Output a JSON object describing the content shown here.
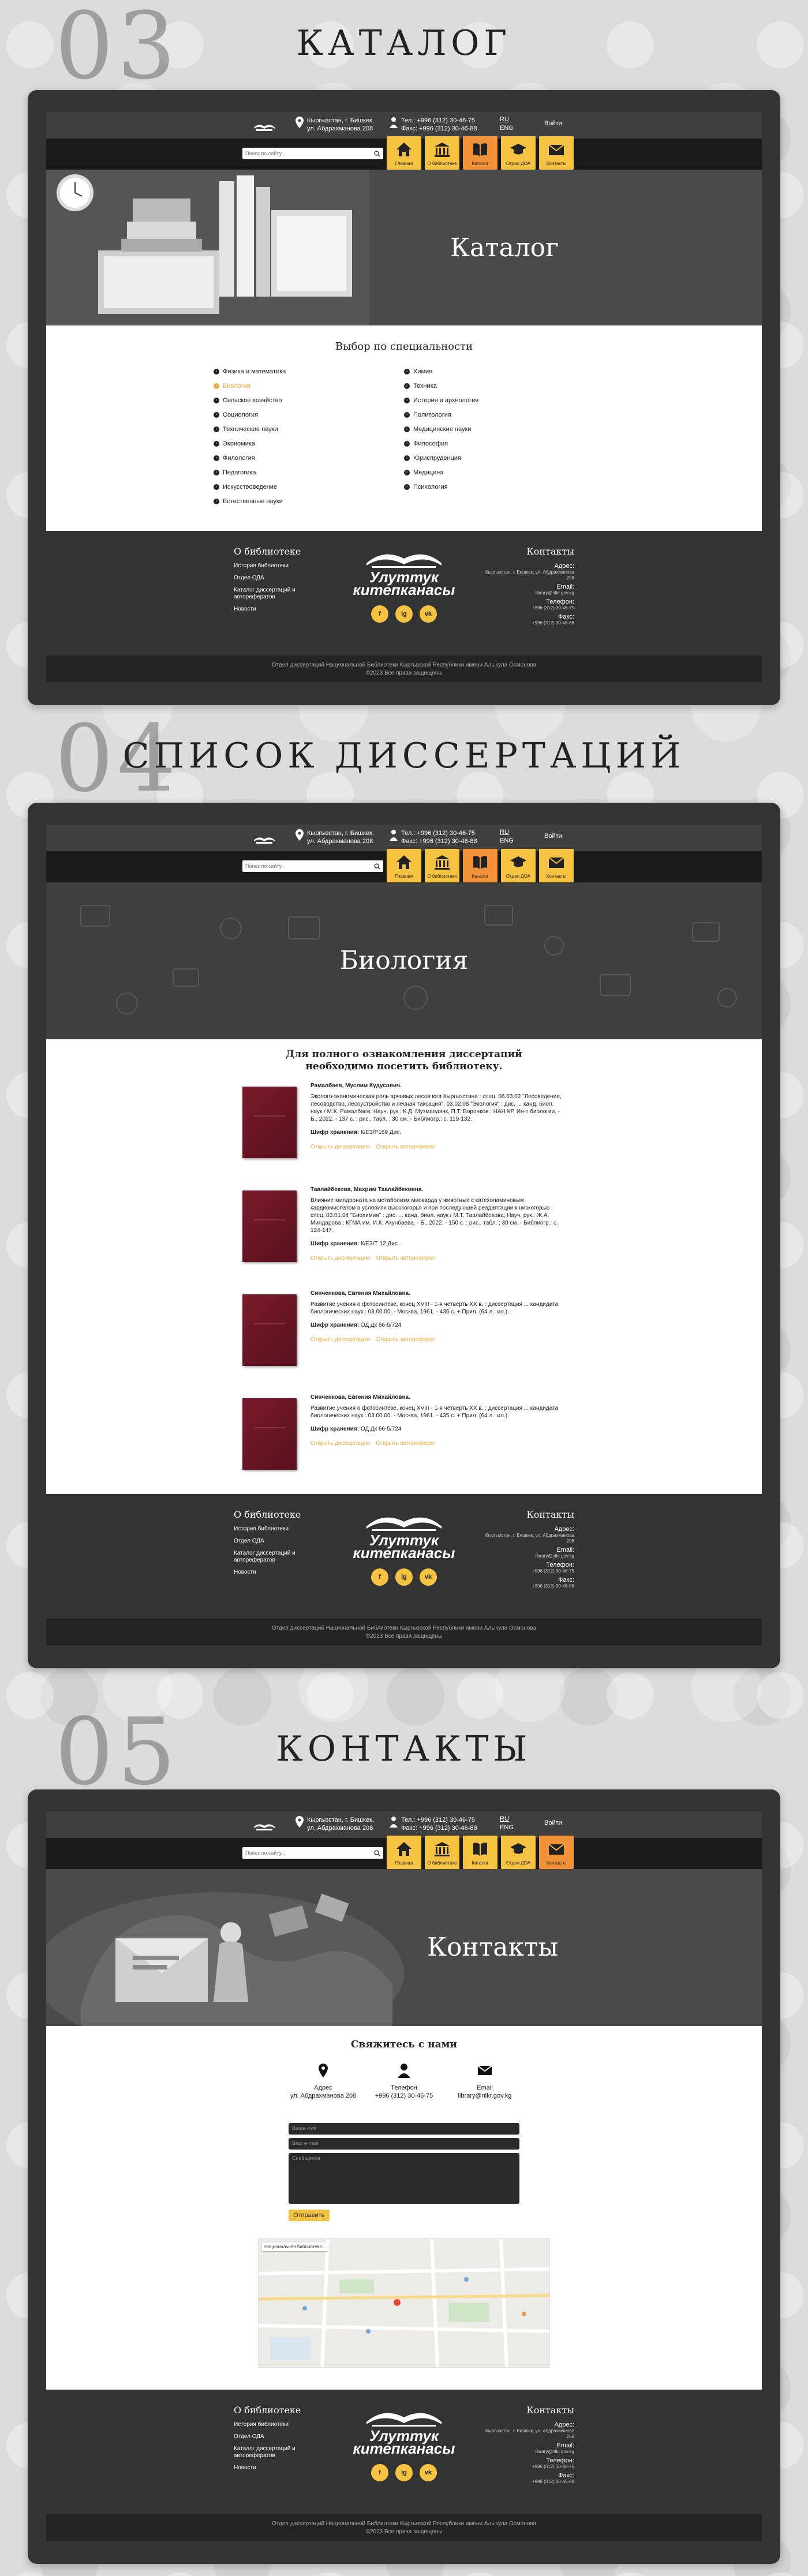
{
  "sections": [
    {
      "num": "03",
      "title": "КАТАЛОГ"
    },
    {
      "num": "04",
      "title": "СПИСОК ДИССЕРТАЦИЙ"
    },
    {
      "num": "05",
      "title": "КОНТАКТЫ"
    }
  ],
  "header": {
    "address": [
      "Кыргызстан, г. Бишкек,",
      "ул. Абдрахманова 208"
    ],
    "phone": "Тел.: +996 (312) 30-46-75",
    "fax": "Факс: +996 (312) 30-46-88",
    "lang_ru": "RU",
    "lang_en": "ENG",
    "login": "Войти",
    "search_placeholder": "Поиск по сайту...",
    "nav": [
      {
        "label": "Главная",
        "icon": "home-icon"
      },
      {
        "label": "О библиотеке",
        "icon": "library-icon"
      },
      {
        "label": "Каталог",
        "icon": "book-icon"
      },
      {
        "label": "Отдел ДОА",
        "icon": "graduation-cap-icon"
      },
      {
        "label": "Контакты",
        "icon": "mail-icon"
      }
    ]
  },
  "catalog": {
    "hero_title": "Каталог",
    "heading": "Выбор по специальности",
    "specialties": [
      {
        "label": "Физика и математика",
        "active": false
      },
      {
        "label": "Биология",
        "active": true
      },
      {
        "label": "Сельское хозяйство",
        "active": false
      },
      {
        "label": "Социология",
        "active": false
      },
      {
        "label": "Технические науки",
        "active": false
      },
      {
        "label": "Экономика",
        "active": false
      },
      {
        "label": "Филология",
        "active": false
      },
      {
        "label": "Педагогика",
        "active": false
      },
      {
        "label": "Искусствоведение",
        "active": false
      },
      {
        "label": "Естественные науки",
        "active": false
      },
      {
        "label": "Химия",
        "active": false
      },
      {
        "label": "Техника",
        "active": false
      },
      {
        "label": "История и археология",
        "active": false
      },
      {
        "label": "Политология",
        "active": false
      },
      {
        "label": "Медицинские науки",
        "active": false
      },
      {
        "label": "Философия",
        "active": false
      },
      {
        "label": "Юриспруденция",
        "active": false
      },
      {
        "label": "Медицина",
        "active": false
      },
      {
        "label": "Психология",
        "active": false
      }
    ]
  },
  "dissertations": {
    "hero_title": "Биология",
    "heading": "Для полного ознакомления диссертаций необходимо посетить библиотеку.",
    "cipher_label": "Шифр хранения:",
    "open_diss": "Открыть диссертацию",
    "open_abstract": "Открыть автореферат",
    "entries": [
      {
        "author": "Рамалбаев, Муслим Кудусович.",
        "desc": "Эколого-экономическая роль арчовых лесов юга Кыргызстана : спец. 06.03.02 \"Лесоведение, лесоводство, лесоустройство и лесная таксация\", 03.02.08 \"Экология\" : дис. ... канд. биол. наук / М.К. Рамалбаев; Науч. рук.: К.Д. Музмаедэнк, П.Т. Воронков ; НАН КР, Ин-т биологии. - Б., 2022. - 137 с. : рис., табл. ; 30 см. - Библиогр.: с. 119-132.",
        "cipher": "К/ЕЗ/Р169 Дис."
      },
      {
        "author": "Таалайбекова, Махрим Таалайбековна.",
        "desc": "Влияние милдроната на метаболизм миокарда у животных с катехоламиновым кардиомиопатом в условиях высокогорья и при последующей реадаптации к низкогорью : спец. 03.01.04 \"Биохимия\" : дис. ... канд. биол. наук / М.Т. Таалайбекова; Науч. рук.: Ж.А. Миндарова ; КГМА им. И.К. Ахунбаева. - Б., 2022. - 150 с. : рис., табл. ; 30 см. - Библиогр.: с. 124-147.",
        "cipher": "К/ЕЗ/Т 12 Дис."
      },
      {
        "author": "Синченкова, Евгения Михайловна.",
        "desc": "Развитие учения о фотосинтезе, конец XVIII - 1-я четверть XX в. : диссертация ... кандидата биологических наук : 03.00.00. - Москва, 1961. - 435 с. + Прил. (64 л.: ил.).",
        "cipher": "ОД Дк 66-5/724"
      },
      {
        "author": "Синченкова, Евгения Михайловна.",
        "desc": "Развитие учения о фотосинтезе, конец XVIII - 1-я четверть XX в. : диссертация ... кандидата биологических наук : 03.00.00. - Москва, 1961. - 435 с. + Прил. (64 л.: ил.).",
        "cipher": "ОД Дк 66-5/724"
      }
    ]
  },
  "contacts": {
    "hero_title": "Контакты",
    "heading": "Свяжитесь с нами",
    "items": [
      {
        "title": "Адрес",
        "value": "ул. Абдрахманова 208",
        "icon": "map-pin-icon"
      },
      {
        "title": "Телефон",
        "value": "+996 (312) 30-46-75",
        "icon": "person-icon"
      },
      {
        "title": "Email",
        "value": "library@nlkr.gov.kg",
        "icon": "envelope-icon"
      }
    ],
    "form": {
      "name_placeholder": "Ваше имя",
      "email_placeholder": "Ваш e-mail",
      "message_placeholder": "Сообщение",
      "send": "Отправить"
    },
    "map_label": "Национальная библиотека..."
  },
  "footer": {
    "about_title": "О библиотеке",
    "about_links": [
      "История библиотеки",
      "Отдел ОДА",
      "Каталог диссертаций и авторефератов",
      "Новости"
    ],
    "brand_line1": "Улуттук",
    "brand_line2": "китепканасы",
    "socials": [
      "f",
      "ig",
      "vk"
    ],
    "contacts_title": "Контакты",
    "address_label": "Адрес:",
    "address_value": "Кыргызстан, г. Бишкек, ул. Абдрахманова 208",
    "email_label": "Email:",
    "email_value": "library@nlkr.gov.kg",
    "phone_label": "Телефон:",
    "phone_value": "+996 (312) 30-46-75",
    "fax_label": "Факс:",
    "fax_value": "+996 (312) 30-46-88",
    "copyright1": "Отдел диссертаций Национальной Библиотеки Кыргызской Республики имени Алыкула Осмонова",
    "copyright2": "©2023 Все права защищены"
  }
}
